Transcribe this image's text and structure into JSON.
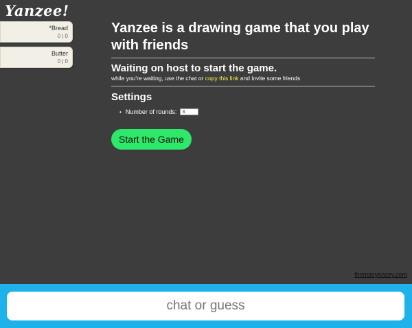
{
  "app": {
    "logo": "Yanzee!"
  },
  "players": [
    {
      "name": "*Bread",
      "score": "0 | 0"
    },
    {
      "name": "Butter",
      "score": "0 | 0"
    }
  ],
  "main": {
    "title": "Yanzee is a drawing game that you play with friends",
    "status_title": "Waiting on host to start the game.",
    "status_pre": "while you're waiting, use the chat or ",
    "status_link": "copy this link",
    "status_post": " and invite some friends",
    "settings_title": "Settings",
    "rounds_label": "Number of rounds:",
    "rounds_value": "3",
    "start_button": "Start the Game"
  },
  "footer": {
    "credit": "thomasyancey.com",
    "chat_placeholder": "chat or guess"
  },
  "colors": {
    "background": "#3d3d3d",
    "accent_green": "#2ee86a",
    "footer_blue": "#1fb1ea",
    "link_yellow": "#f3f34a"
  }
}
